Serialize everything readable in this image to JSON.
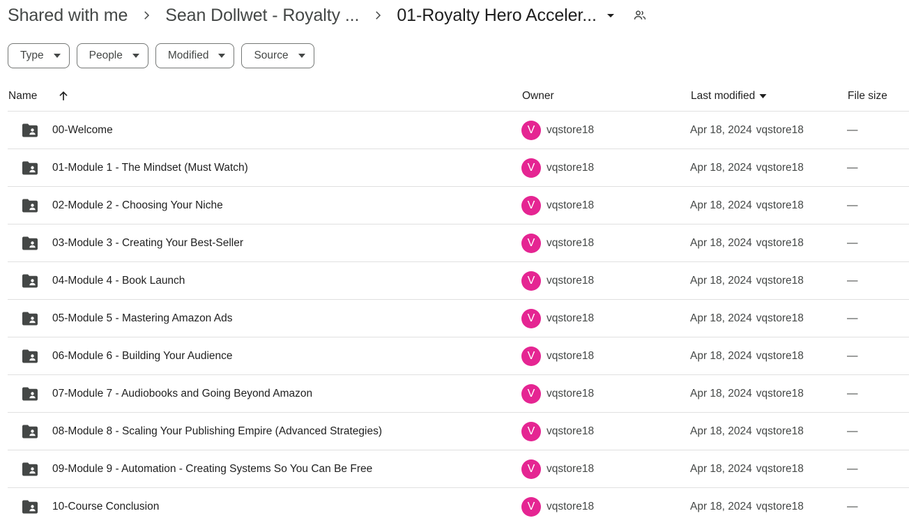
{
  "breadcrumb": {
    "root": "Shared with me",
    "parent": "Sean Dollwet - Royalty ...",
    "current": "01-Royalty Hero Acceler..."
  },
  "filters": [
    "Type",
    "People",
    "Modified",
    "Source"
  ],
  "table": {
    "headers": {
      "name": "Name",
      "owner": "Owner",
      "last_modified": "Last modified",
      "file_size": "File size"
    },
    "rows": [
      {
        "name": "00-Welcome",
        "owner_initial": "V",
        "owner": "vqstore18",
        "date": "Apr 18, 2024",
        "modified_by": "vqstore18",
        "size": "—"
      },
      {
        "name": "01-Module 1 - The Mindset (Must Watch)",
        "owner_initial": "V",
        "owner": "vqstore18",
        "date": "Apr 18, 2024",
        "modified_by": "vqstore18",
        "size": "—"
      },
      {
        "name": "02-Module 2 - Choosing Your Niche",
        "owner_initial": "V",
        "owner": "vqstore18",
        "date": "Apr 18, 2024",
        "modified_by": "vqstore18",
        "size": "—"
      },
      {
        "name": "03-Module 3 - Creating Your Best-Seller",
        "owner_initial": "V",
        "owner": "vqstore18",
        "date": "Apr 18, 2024",
        "modified_by": "vqstore18",
        "size": "—"
      },
      {
        "name": "04-Module 4 - Book Launch",
        "owner_initial": "V",
        "owner": "vqstore18",
        "date": "Apr 18, 2024",
        "modified_by": "vqstore18",
        "size": "—"
      },
      {
        "name": "05-Module 5 - Mastering Amazon Ads",
        "owner_initial": "V",
        "owner": "vqstore18",
        "date": "Apr 18, 2024",
        "modified_by": "vqstore18",
        "size": "—"
      },
      {
        "name": "06-Module 6 - Building Your Audience",
        "owner_initial": "V",
        "owner": "vqstore18",
        "date": "Apr 18, 2024",
        "modified_by": "vqstore18",
        "size": "—"
      },
      {
        "name": "07-Module 7 - Audiobooks and Going Beyond Amazon",
        "owner_initial": "V",
        "owner": "vqstore18",
        "date": "Apr 18, 2024",
        "modified_by": "vqstore18",
        "size": "—"
      },
      {
        "name": "08-Module 8 - Scaling Your Publishing Empire (Advanced Strategies)",
        "owner_initial": "V",
        "owner": "vqstore18",
        "date": "Apr 18, 2024",
        "modified_by": "vqstore18",
        "size": "—"
      },
      {
        "name": "09-Module 9 - Automation - Creating Systems So You Can Be Free",
        "owner_initial": "V",
        "owner": "vqstore18",
        "date": "Apr 18, 2024",
        "modified_by": "vqstore18",
        "size": "—"
      },
      {
        "name": "10-Course Conclusion",
        "owner_initial": "V",
        "owner": "vqstore18",
        "date": "Apr 18, 2024",
        "modified_by": "vqstore18",
        "size": "—"
      }
    ]
  },
  "icons": {
    "breadcrumb_separator": "chevron-right-icon",
    "folder_dropdown": "arrow-drop-down-icon",
    "shared": "people-icon",
    "sort": "arrow-up-icon",
    "folder": "shared-folder-icon"
  },
  "colors": {
    "avatar": "#e52592",
    "divider": "#e0e0e0"
  }
}
